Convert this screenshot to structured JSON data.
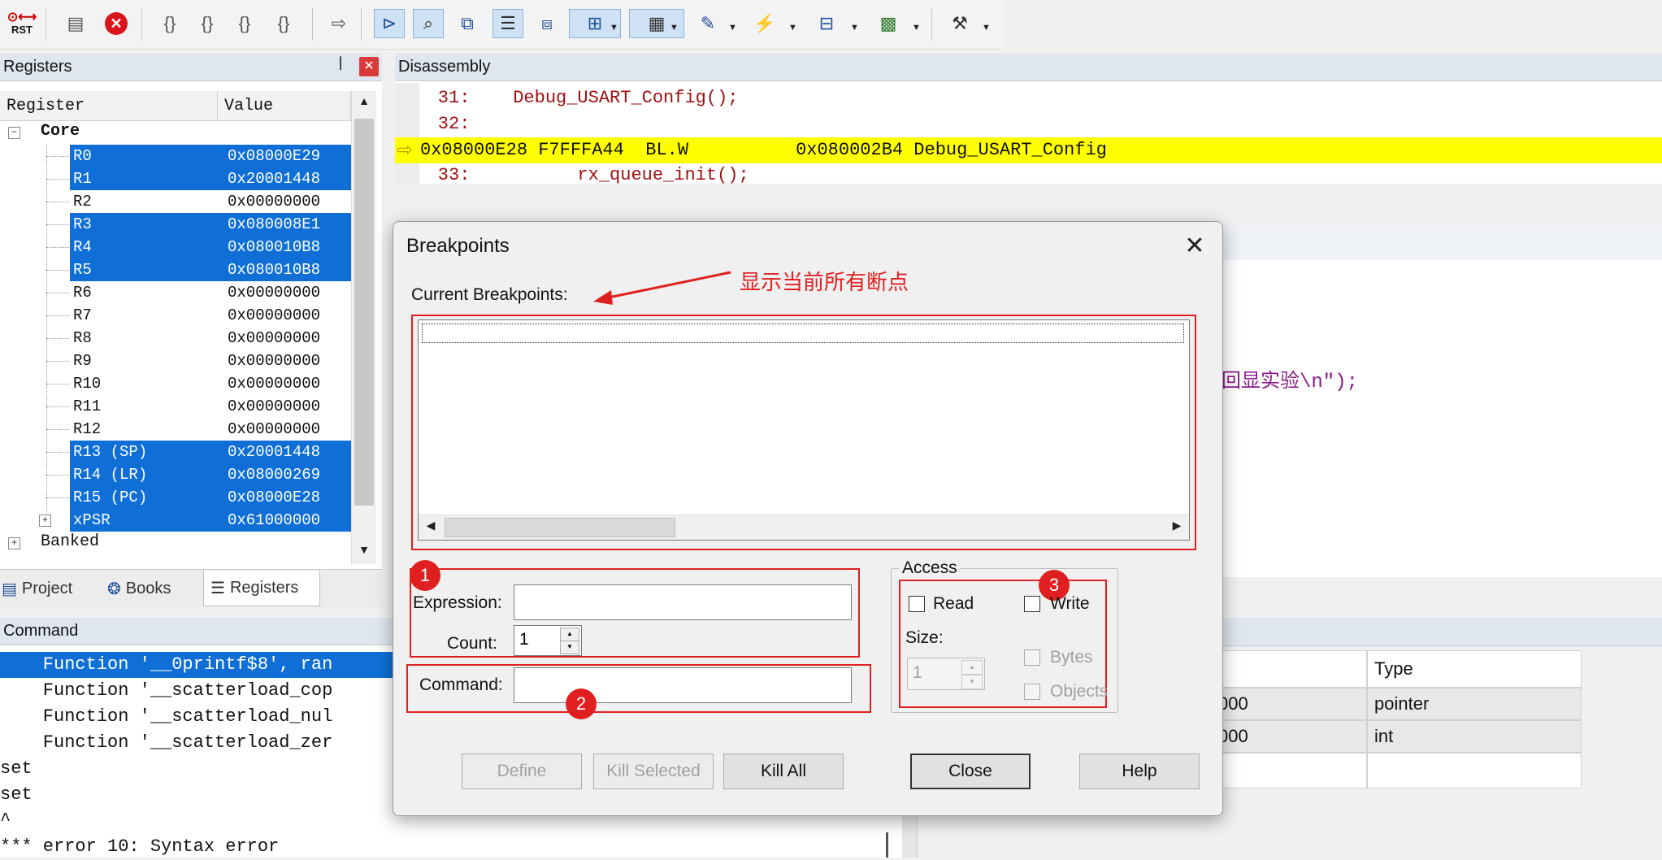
{
  "toolbar": {
    "reset_label": "RST"
  },
  "registers_panel": {
    "title": "Registers",
    "columns": [
      "Register",
      "Value"
    ],
    "core_label": "Core",
    "rows": [
      {
        "name": "R0",
        "value": "0x08000E29",
        "selected": true
      },
      {
        "name": "R1",
        "value": "0x20001448",
        "selected": true
      },
      {
        "name": "R2",
        "value": "0x00000000",
        "selected": false
      },
      {
        "name": "R3",
        "value": "0x080008E1",
        "selected": true
      },
      {
        "name": "R4",
        "value": "0x080010B8",
        "selected": true
      },
      {
        "name": "R5",
        "value": "0x080010B8",
        "selected": true
      },
      {
        "name": "R6",
        "value": "0x00000000",
        "selected": false
      },
      {
        "name": "R7",
        "value": "0x00000000",
        "selected": false
      },
      {
        "name": "R8",
        "value": "0x00000000",
        "selected": false
      },
      {
        "name": "R9",
        "value": "0x00000000",
        "selected": false
      },
      {
        "name": "R10",
        "value": "0x00000000",
        "selected": false
      },
      {
        "name": "R11",
        "value": "0x00000000",
        "selected": false
      },
      {
        "name": "R12",
        "value": "0x00000000",
        "selected": false
      },
      {
        "name": "R13 (SP)",
        "value": "0x20001448",
        "selected": true
      },
      {
        "name": "R14 (LR)",
        "value": "0x08000269",
        "selected": true
      },
      {
        "name": "R15 (PC)",
        "value": "0x08000E28",
        "selected": true
      },
      {
        "name": "xPSR",
        "value": "0x61000000",
        "selected": true
      }
    ],
    "banked_label": "Banked",
    "tabs": [
      {
        "label": "Project"
      },
      {
        "label": "Books"
      },
      {
        "label": "Registers"
      }
    ]
  },
  "disassembly": {
    "title": "Disassembly",
    "lines": [
      "    31:    Debug_USART_Config();",
      "    32:",
      "0x08000E28 F7FFFA44  BL.W          0x080002B4 Debug_USART_Config",
      "    33:          rx_queue_init();"
    ],
    "partial_text": "回显实验\\n\");"
  },
  "command": {
    "title": "Command",
    "lines": [
      "    Function '__0printf$8', ran",
      "    Function '__scatterload_cop",
      "    Function '__scatterload_nul",
      "    Function '__scatterload_zer",
      "set",
      "set",
      "^",
      "*** error 10: Syntax error"
    ]
  },
  "watch_table": {
    "header": "Type",
    "rows": [
      {
        "value": "000",
        "type": "pointer"
      },
      {
        "value": "000",
        "type": "int"
      }
    ]
  },
  "dialog": {
    "title": "Breakpoints",
    "current_label": "Current Breakpoints:",
    "annotation": "显示当前所有断点",
    "expression_label": "Expression:",
    "count_label": "Count:",
    "count_value": "1",
    "command_label": "Command:",
    "access_label": "Access",
    "read_label": "Read",
    "write_label": "Write",
    "size_label": "Size:",
    "size_value": "1",
    "bytes_label": "Bytes",
    "objects_label": "Objects",
    "buttons": {
      "define": "Define",
      "kill_selected": "Kill Selected",
      "kill_all": "Kill All",
      "close": "Close",
      "help": "Help"
    },
    "badges": [
      "1",
      "2",
      "3"
    ]
  },
  "colors": {
    "selection": "#0f6fd6",
    "highlight": "#ffff00",
    "annotation": "#e02020"
  }
}
